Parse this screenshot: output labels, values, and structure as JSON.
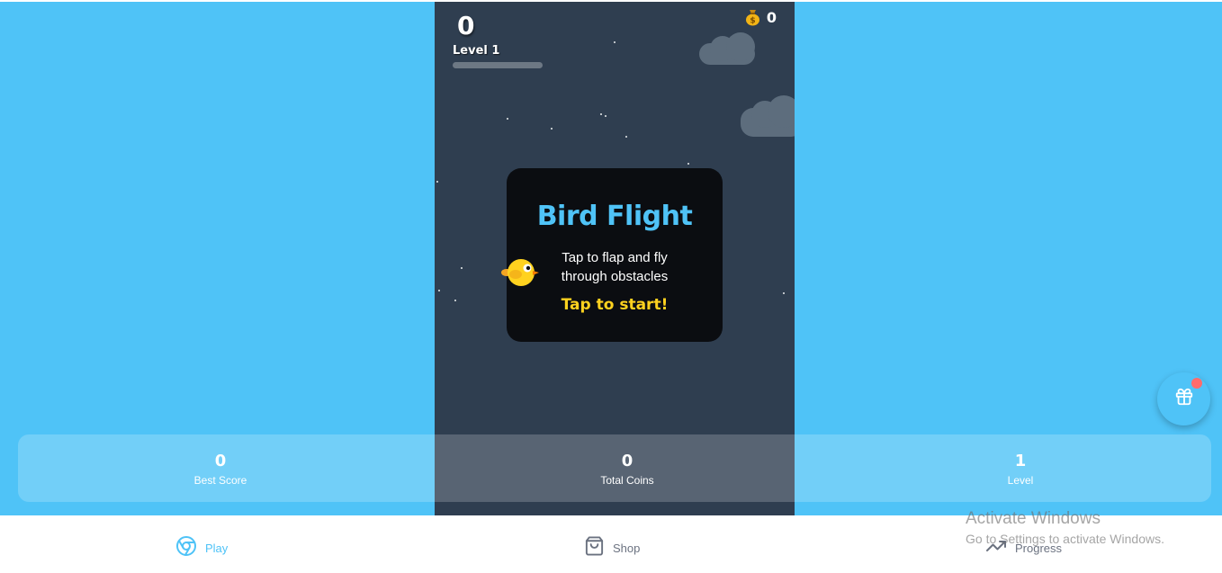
{
  "game": {
    "score": "0",
    "level_label": "Level 1",
    "level_progress": 0,
    "coins": "0",
    "coin_icon": "money-bag-icon"
  },
  "start_card": {
    "title": "Bird Flight",
    "instructions": "Tap to flap and fly through obstacles",
    "prompt": "Tap to start!"
  },
  "stats": [
    {
      "value": "0",
      "label": "Best Score"
    },
    {
      "value": "0",
      "label": "Total Coins"
    },
    {
      "value": "1",
      "label": "Level"
    }
  ],
  "gift_button": {
    "icon": "gift-icon",
    "has_notification": true
  },
  "nav": [
    {
      "label": "Play",
      "icon": "chrome-icon",
      "active": true
    },
    {
      "label": "Shop",
      "icon": "shopping-bag-icon",
      "active": false
    },
    {
      "label": "Progress",
      "icon": "trending-up-icon",
      "active": false
    }
  ],
  "watermark": {
    "title": "Activate Windows",
    "subtitle": "Go to Settings to activate Windows."
  },
  "colors": {
    "sky": "#4fc3f7",
    "game_bg": "#2f3e50",
    "accent_title": "#4fc3f7",
    "accent_prompt": "#ffd21f",
    "bird": "#ffd21f",
    "notification": "#ff6b6b"
  }
}
